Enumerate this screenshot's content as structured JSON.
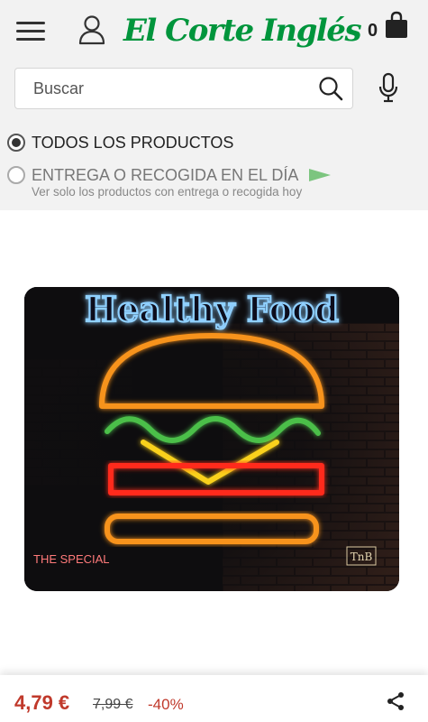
{
  "header": {
    "brand": "El Corte Inglés",
    "cart_count": "0"
  },
  "search": {
    "placeholder": "Buscar"
  },
  "filters": {
    "all_products": "TODOS LOS PRODUCTOS",
    "same_day": "ENTREGA O RECOGIDA EN EL DÍA",
    "same_day_sub": "Ver solo los productos con entrega o recogida hoy"
  },
  "product": {
    "image_title": "Healthy Food",
    "image_caption": "THE SPECIAL",
    "image_badge": "TnB"
  },
  "price": {
    "current": "4,79 €",
    "original": "7,99 €",
    "discount": "-40%"
  },
  "colors": {
    "brand_green": "#00953c",
    "price_red": "#c0392b"
  },
  "icons": [
    "menu-icon",
    "user-icon",
    "bag-icon",
    "search-icon",
    "microphone-icon",
    "flag-icon",
    "share-icon"
  ]
}
